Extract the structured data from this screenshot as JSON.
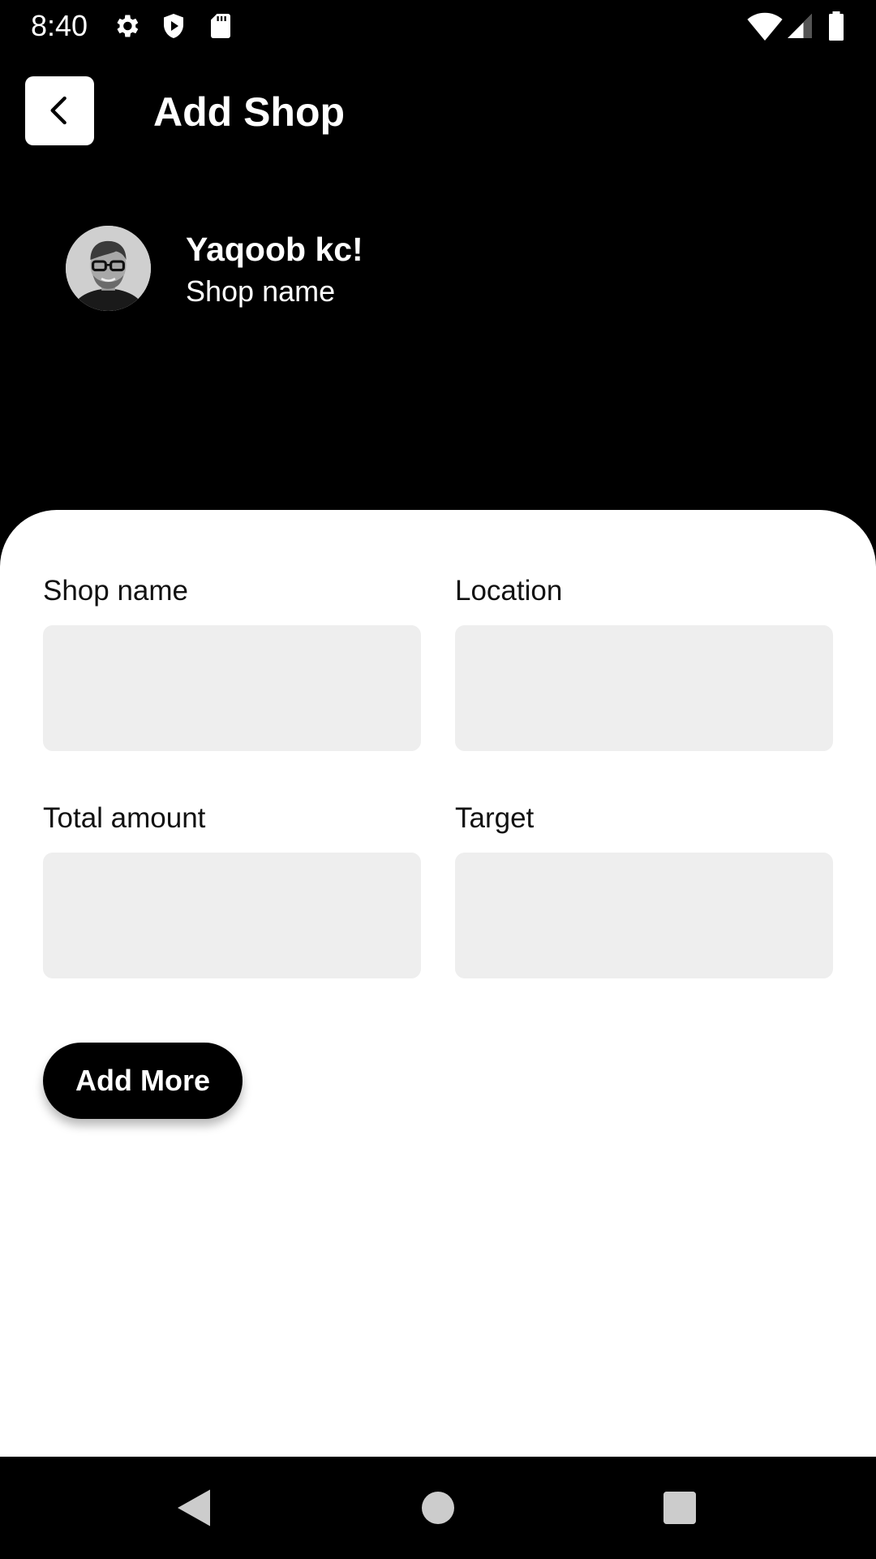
{
  "status_bar": {
    "time": "8:40",
    "left_icons": [
      "gear-icon",
      "shield-icon",
      "sd-card-icon"
    ],
    "right_icons": [
      "wifi-icon",
      "signal-icon",
      "battery-icon"
    ]
  },
  "header": {
    "title": "Add Shop",
    "back_icon": "chevron-left-icon"
  },
  "profile": {
    "name": "Yaqoob kc!",
    "subtitle": "Shop name"
  },
  "form": {
    "fields": [
      {
        "label": "Shop name",
        "value": ""
      },
      {
        "label": "Location",
        "value": ""
      },
      {
        "label": "Total amount",
        "value": ""
      },
      {
        "label": "Target",
        "value": ""
      }
    ],
    "add_more_label": "Add More"
  },
  "nav_bar": {
    "icons": [
      "nav-back-icon",
      "nav-home-icon",
      "nav-recents-icon"
    ]
  },
  "colors": {
    "background": "#000000",
    "card": "#ffffff",
    "input_fill": "#eeeeee",
    "button": "#000000"
  }
}
